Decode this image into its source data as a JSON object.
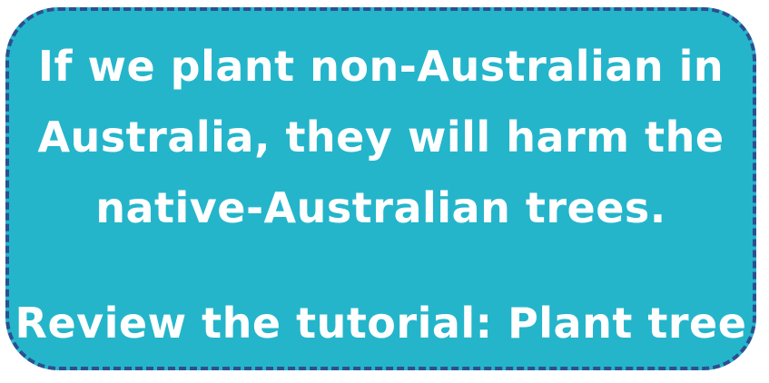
{
  "dialog": {
    "message_lines": [
      "If we plant non-Australian in",
      "Australia, they will harm the",
      "native-Australian trees."
    ],
    "tutorial_text": "Review the tutorial: Plant tree"
  },
  "colors": {
    "card_background": "#24b5cb",
    "card_border": "#2e4f8f",
    "text": "#ffffff"
  }
}
